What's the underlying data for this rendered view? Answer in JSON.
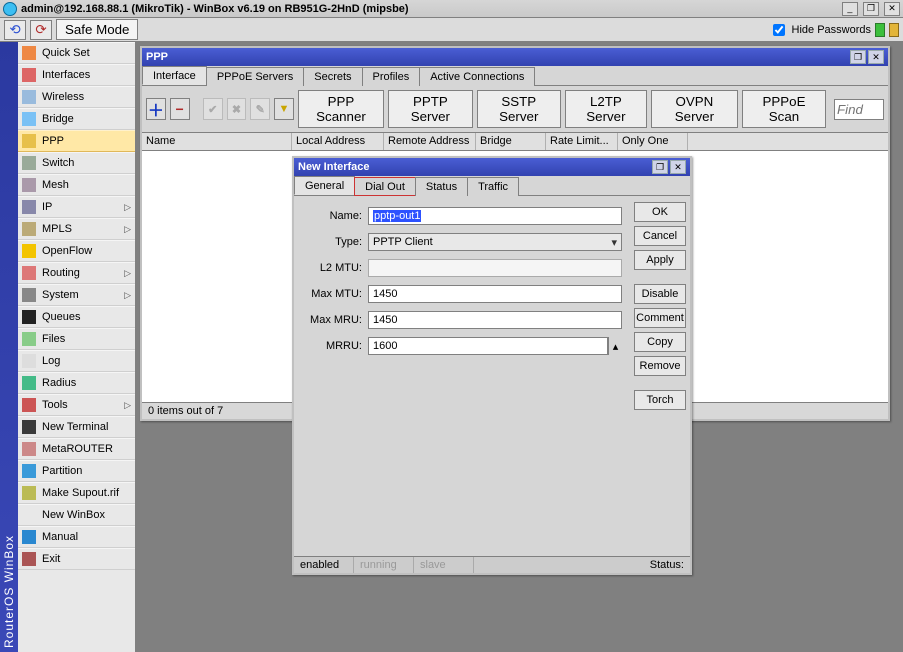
{
  "window": {
    "title": "admin@192.168.88.1 (MikroTik) - WinBox v6.19 on RB951G-2HnD (mipsbe)"
  },
  "toolbar": {
    "safe_mode": "Safe Mode",
    "hide_passwords": "Hide Passwords"
  },
  "branding": {
    "vertical_label": "RouterOS WinBox"
  },
  "sidebar": {
    "items": [
      {
        "label": "Quick Set",
        "icon": "#e84",
        "caret": false
      },
      {
        "label": "Interfaces",
        "icon": "#d66",
        "caret": false
      },
      {
        "label": "Wireless",
        "icon": "#9bd",
        "caret": false
      },
      {
        "label": "Bridge",
        "icon": "#7ac1f5",
        "caret": false
      },
      {
        "label": "PPP",
        "icon": "#e7c04a",
        "caret": false,
        "hi": true
      },
      {
        "label": "Switch",
        "icon": "#9a9",
        "caret": false
      },
      {
        "label": "Mesh",
        "icon": "#a9a",
        "caret": false
      },
      {
        "label": "IP",
        "icon": "#88a",
        "caret": true
      },
      {
        "label": "MPLS",
        "icon": "#ba7",
        "caret": true
      },
      {
        "label": "OpenFlow",
        "icon": "#f3c400",
        "caret": false
      },
      {
        "label": "Routing",
        "icon": "#d77",
        "caret": true
      },
      {
        "label": "System",
        "icon": "#888",
        "caret": true
      },
      {
        "label": "Queues",
        "icon": "#222",
        "caret": false
      },
      {
        "label": "Files",
        "icon": "#8c8",
        "caret": false
      },
      {
        "label": "Log",
        "icon": "#ddd",
        "caret": false
      },
      {
        "label": "Radius",
        "icon": "#4b8",
        "caret": false
      },
      {
        "label": "Tools",
        "icon": "#c55",
        "caret": true
      },
      {
        "label": "New Terminal",
        "icon": "#3a3a3a",
        "caret": false
      },
      {
        "label": "MetaROUTER",
        "icon": "#c88",
        "caret": false
      },
      {
        "label": "Partition",
        "icon": "#3a9ad9",
        "caret": false
      },
      {
        "label": "Make Supout.rif",
        "icon": "#bb5",
        "caret": false
      },
      {
        "label": "New WinBox",
        "icon": "",
        "caret": false
      },
      {
        "label": "Manual",
        "icon": "#2a88d0",
        "caret": false
      },
      {
        "label": "Exit",
        "icon": "#a55",
        "caret": false
      }
    ]
  },
  "ppp_window": {
    "title": "PPP",
    "tabs": [
      "Interface",
      "PPPoE Servers",
      "Secrets",
      "Profiles",
      "Active Connections"
    ],
    "active_tab": "Interface",
    "server_buttons": [
      "PPP Scanner",
      "PPTP Server",
      "SSTP Server",
      "L2TP Server",
      "OVPN Server",
      "PPPoE Scan"
    ],
    "find_placeholder": "Find",
    "columns": [
      "Name",
      "Local Address",
      "Remote Address",
      "Bridge",
      "Rate Limit...",
      "Only One"
    ],
    "status": "0 items out of 7"
  },
  "dialog": {
    "title": "New Interface",
    "tabs": [
      "General",
      "Dial Out",
      "Status",
      "Traffic"
    ],
    "active_tab": "General",
    "fields": {
      "name_label": "Name:",
      "name_value": "pptp-out1",
      "type_label": "Type:",
      "type_value": "PPTP Client",
      "l2mtu_label": "L2 MTU:",
      "l2mtu_value": "",
      "maxmtu_label": "Max MTU:",
      "maxmtu_value": "1450",
      "maxmru_label": "Max MRU:",
      "maxmru_value": "1450",
      "mrru_label": "MRRU:",
      "mrru_value": "1600"
    },
    "buttons": [
      "OK",
      "Cancel",
      "Apply",
      "Disable",
      "Comment",
      "Copy",
      "Remove",
      "Torch"
    ],
    "status": {
      "enabled": "enabled",
      "running": "running",
      "slave": "slave",
      "label": "Status:"
    }
  }
}
